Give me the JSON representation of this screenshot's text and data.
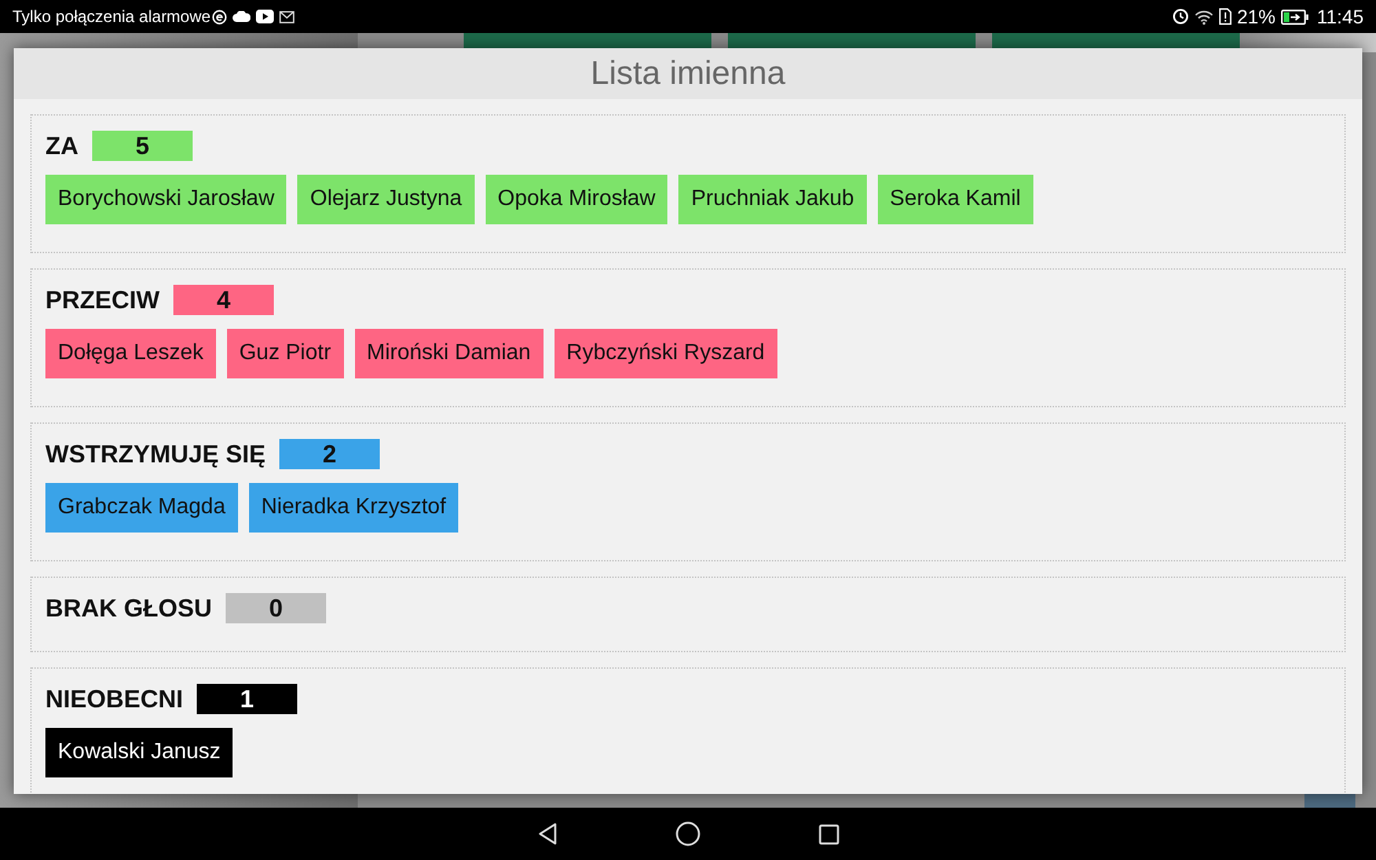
{
  "status_bar": {
    "carrier_text": "Tylko połączenia alarmowe",
    "battery": "21%",
    "time": "11:45"
  },
  "dialog": {
    "title": "Lista imienna",
    "groups": [
      {
        "label": "ZA",
        "count": "5",
        "color": "#7de36a",
        "members": [
          "Borychowski Jarosław",
          "Olejarz Justyna",
          "Opoka Mirosław",
          "Pruchniak Jakub",
          "Seroka Kamil"
        ]
      },
      {
        "label": "PRZECIW",
        "count": "4",
        "color": "#fe6583",
        "members": [
          "Dołęga Leszek",
          "Guz Piotr",
          "Miroński Damian",
          "Rybczyński Ryszard"
        ]
      },
      {
        "label": "WSTRZYMUJĘ SIĘ",
        "count": "2",
        "color": "#3aa3e8",
        "members": [
          "Grabczak Magda",
          "Nieradka Krzysztof"
        ]
      },
      {
        "label": "BRAK GŁOSU",
        "count": "0",
        "color": "#c0c0c0"
      },
      {
        "label": "NIEOBECNI",
        "count": "1",
        "color": "#000000",
        "members": [
          "Kowalski Janusz"
        ]
      }
    ]
  }
}
